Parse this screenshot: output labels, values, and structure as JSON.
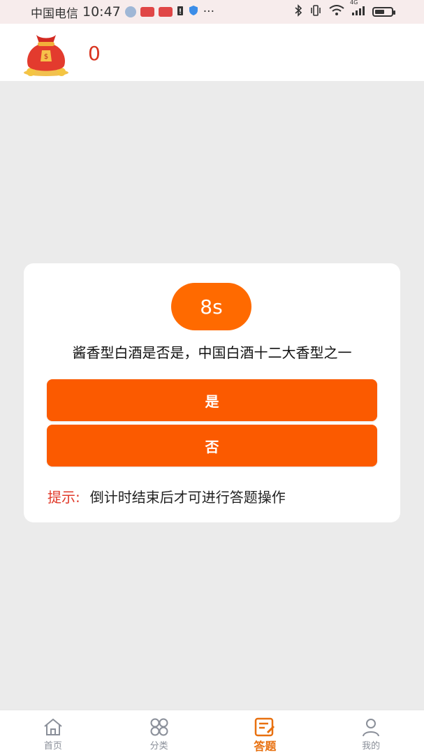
{
  "status_bar": {
    "carrier": "中国电信",
    "time": "10:47",
    "network": "4G",
    "more": "···"
  },
  "header": {
    "icon": "money-bag-icon",
    "coins": "0"
  },
  "quiz": {
    "timer": "8s",
    "question": "酱香型白酒是否是，中国白酒十二大香型之一",
    "answers": [
      "是",
      "否"
    ],
    "hint_label": "提示:",
    "hint_text": "倒计时结束后才可进行答题操作"
  },
  "tabs": [
    {
      "label": "首页",
      "icon": "home-icon",
      "active": false
    },
    {
      "label": "分类",
      "icon": "category-icon",
      "active": false
    },
    {
      "label": "答题",
      "icon": "answer-icon",
      "active": true
    },
    {
      "label": "我的",
      "icon": "profile-icon",
      "active": false
    }
  ],
  "colors": {
    "accent": "#fb5a00",
    "timer": "#ff6a00",
    "coin_text": "#d9341f",
    "hint_label": "#e03a2a",
    "active_tab": "#e8700f",
    "background": "#ebebeb"
  }
}
